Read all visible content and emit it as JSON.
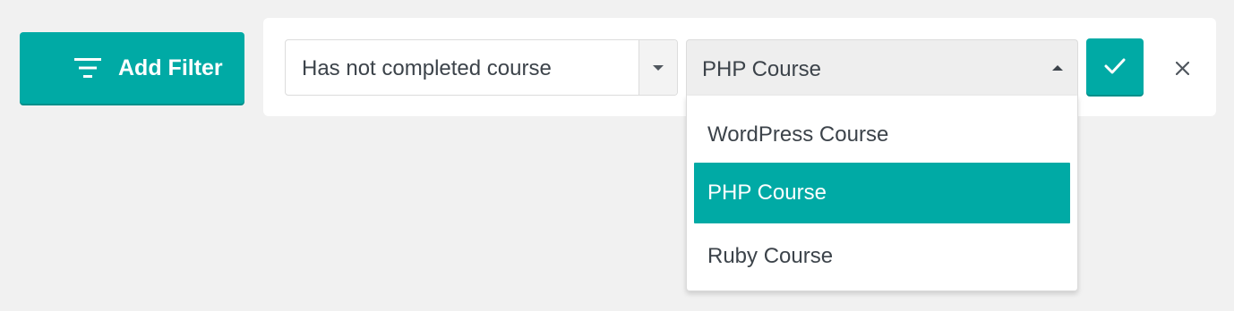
{
  "toolbar": {
    "add_filter_label": "Add Filter",
    "add_filter_icon": "filter-list-icon"
  },
  "filter": {
    "condition": {
      "value": "Has not completed course",
      "arrow_icon": "caret-down-icon"
    },
    "course": {
      "value": "PHP Course",
      "arrow_icon": "caret-up-icon",
      "expanded": true,
      "options": [
        {
          "label": "WordPress Course",
          "selected": false
        },
        {
          "label": "PHP Course",
          "selected": true
        },
        {
          "label": "Ruby Course",
          "selected": false
        }
      ]
    },
    "apply_icon": "checkmark-icon",
    "remove_icon": "close-icon"
  },
  "colors": {
    "accent": "#00aaa5",
    "background": "#f1f1f1",
    "panel": "#ffffff",
    "text": "#3c434a"
  }
}
